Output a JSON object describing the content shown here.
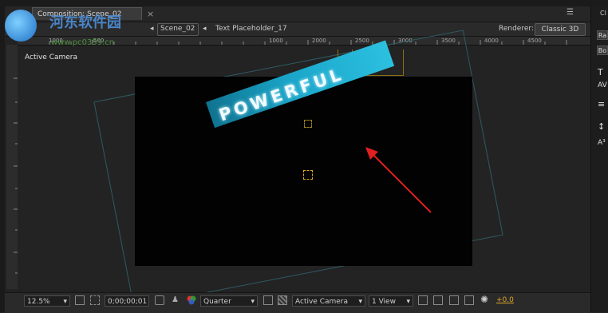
{
  "panel": {
    "tab_title": "Composition: Scene_02",
    "tab_close": "×",
    "menu_glyph": "☰",
    "breadcrumb": {
      "nav_prev": "◂",
      "scene": "Scene_02",
      "nav_sep": "◂",
      "layer": "Text Placeholder_17"
    },
    "renderer_label": "Renderer:",
    "renderer_value": "Classic 3D"
  },
  "ruler": {
    "top_ticks": [
      "1000",
      "500",
      "1000",
      "1500",
      "2000",
      "2500",
      "3000",
      "3500",
      "4000",
      "4500"
    ]
  },
  "viewer": {
    "camera_label": "Active Camera",
    "comp_text": "POWERFUL"
  },
  "footer": {
    "zoom": "12.5%",
    "timecode": "0;00;00;01",
    "resolution": "Quarter",
    "view_camera": "Active Camera",
    "view_layout": "1 View",
    "exposure": "+0.0"
  },
  "right_dock": {
    "tab_label": "Cl",
    "btn1": "Ra",
    "btn2": "Bo"
  },
  "watermark": {
    "title": "河东软件园",
    "url": "www.pc0359.cn"
  },
  "colors": {
    "accent": "#e0a72a",
    "text_bar": "#1aa5c8",
    "arrow": "#e02020"
  }
}
